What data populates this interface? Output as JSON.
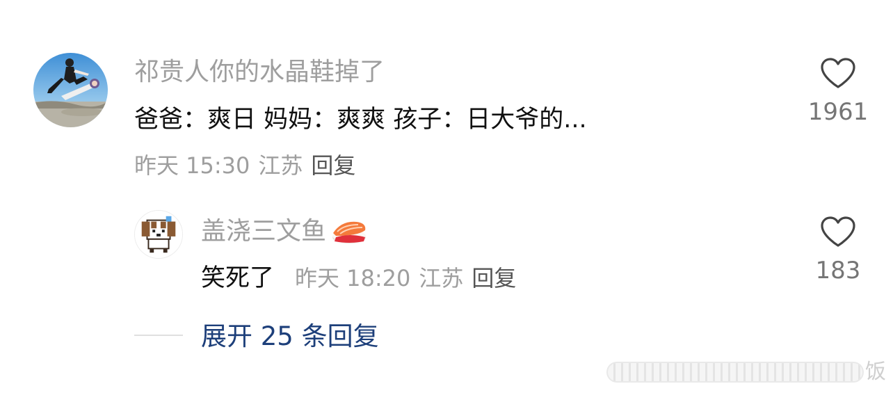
{
  "main_comment": {
    "username": "祁贵人你的水晶鞋掉了",
    "text": "爸爸：爽日 妈妈：爽爽 孩子：日大爷的...",
    "time": "昨天 15:30",
    "location": "江苏",
    "reply_label": "回复",
    "like_count": "1961",
    "like_icon": "heart-outline-icon"
  },
  "reply_comment": {
    "username": "盖浇三文鱼",
    "username_emoji": "sushi-emoji",
    "text": "笑死了",
    "time": "昨天 18:20",
    "location": "江苏",
    "reply_label": "回复",
    "like_count": "183",
    "like_icon": "heart-outline-icon"
  },
  "expand": {
    "label": "展开 25 条回复"
  },
  "watermark": {
    "char": "饭"
  },
  "colors": {
    "username": "#9e9e9e",
    "meta": "#9e9e9e",
    "text": "#111111",
    "link": "#1d3f7a",
    "like_count": "#757575"
  }
}
